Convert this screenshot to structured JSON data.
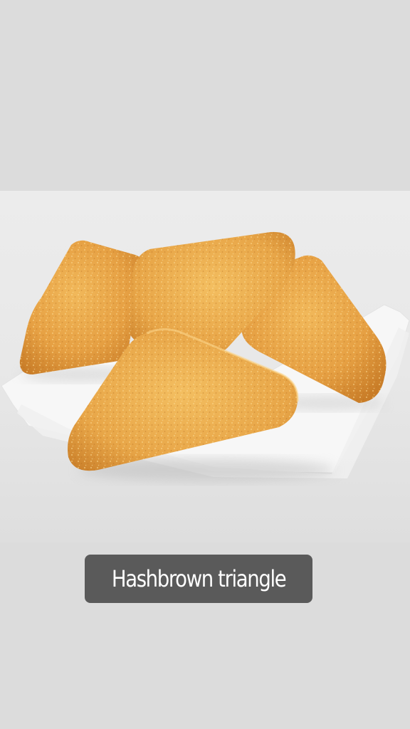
{
  "story": {
    "caption": "Hashbrown triangle",
    "background_color": "#dcdcdc",
    "caption_bg_color": "#5a5a5a",
    "caption_text_color": "#ffffff"
  },
  "photo": {
    "subject": "four golden fried hash brown triangles on white deli paper",
    "item_count": 4
  }
}
